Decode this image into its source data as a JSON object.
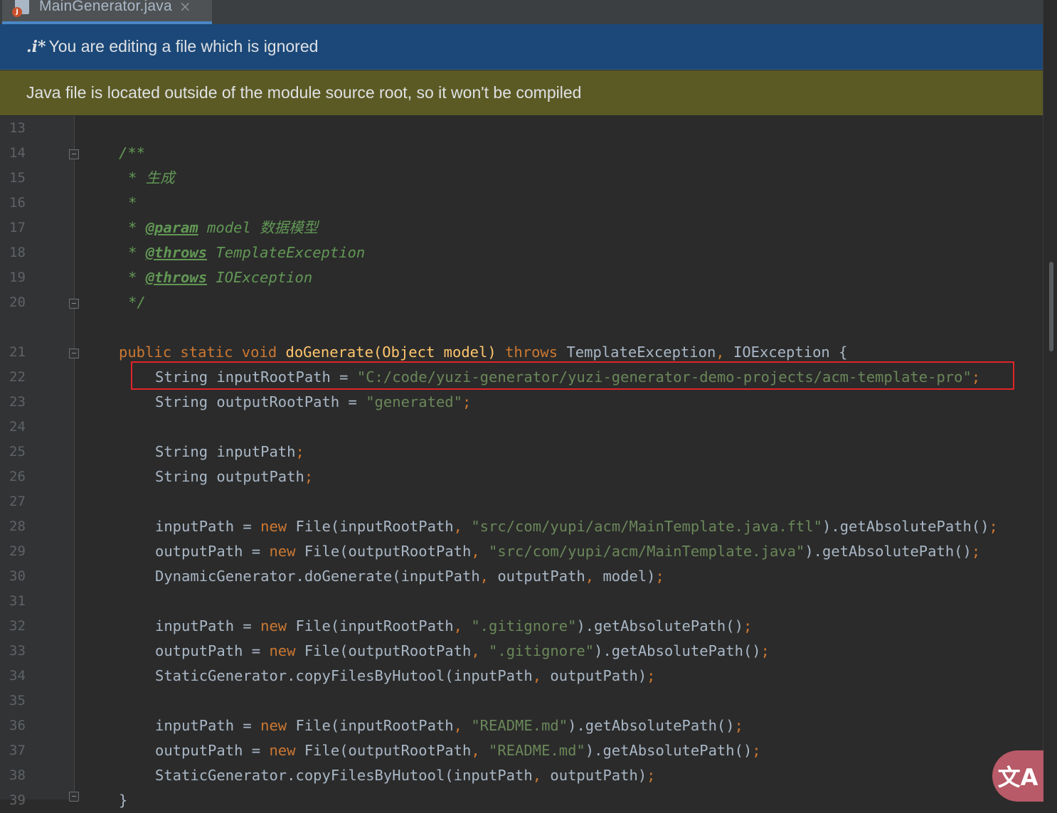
{
  "tab": {
    "title": "MainGenerator.java",
    "close_glyph": "×",
    "icon_letter": "J"
  },
  "banners": {
    "ignored_prefix": ".i*",
    "ignored_text": "You are editing a file which is ignored",
    "warning_text": "Java file is located outside of the module source root, so it won't be compiled"
  },
  "colors": {
    "ignored_banner": "#1b4878",
    "warning_banner": "#5b5a24",
    "highlight_box": "#e0242a",
    "keyword": "#cc7832",
    "string": "#6a8759",
    "doc_comment": "#629755"
  },
  "line_numbers": [
    "13",
    "14",
    "15",
    "16",
    "17",
    "18",
    "19",
    "20",
    "21",
    "22",
    "23",
    "24",
    "25",
    "26",
    "27",
    "28",
    "29",
    "30",
    "31",
    "32",
    "33",
    "34",
    "35",
    "36",
    "37",
    "38",
    "39"
  ],
  "code": {
    "l14": "/**",
    "l15_star": "* ",
    "l15_text": "生成",
    "l16": "*",
    "l17_star": "* ",
    "l17_tag": "@param",
    "l17_name": " model ",
    "l17_desc": "数据模型",
    "l18_star": "* ",
    "l18_tag": "@throws",
    "l18_type": " TemplateException",
    "l19_star": "* ",
    "l19_tag": "@throws",
    "l19_type": " IOException",
    "l20": "*/",
    "l21_kw": "public static void ",
    "l21_name": "doGenerate(Object model) ",
    "l21_throws": "throws ",
    "l21_ex1": "TemplateException",
    "l21_comma": ", ",
    "l21_ex2": "IOException {",
    "l22_decl": "String inputRootPath = ",
    "l22_str": "\"C:/code/yuzi-generator/yuzi-generator-demo-projects/acm-template-pro\"",
    "l23_decl": "String outputRootPath = ",
    "l23_str": "\"generated\"",
    "l25_decl": "String inputPath",
    "l26_decl": "String outputPath",
    "l28_a": "inputPath = ",
    "l28_b": "File(inputRootPath",
    "l28_str": "\"src/com/yupi/acm/MainTemplate.java.ftl\"",
    "l28_c": ").getAbsolutePath()",
    "l29_a": "outputPath = ",
    "l29_b": "File(outputRootPath",
    "l29_str": "\"src/com/yupi/acm/MainTemplate.java\"",
    "l29_c": ").getAbsolutePath()",
    "l30_a": "DynamicGenerator.doGenerate(inputPath",
    "l30_b": "outputPath",
    "l30_c": "model)",
    "l32_a": "inputPath = ",
    "l32_b": "File(inputRootPath",
    "l32_str": "\".gitignore\"",
    "l32_c": ").getAbsolutePath()",
    "l33_a": "outputPath = ",
    "l33_b": "File(outputRootPath",
    "l33_str": "\".gitignore\"",
    "l33_c": ").getAbsolutePath()",
    "l34_a": "StaticGenerator.copyFilesByHutool(inputPath",
    "l34_b": "outputPath)",
    "l36_a": "inputPath = ",
    "l36_b": "File(inputRootPath",
    "l36_str": "\"README.md\"",
    "l36_c": ").getAbsolutePath()",
    "l37_a": "outputPath = ",
    "l37_b": "File(outputRootPath",
    "l37_str": "\"README.md\"",
    "l37_c": ").getAbsolutePath()",
    "l38_a": "StaticGenerator.copyFilesByHutool(inputPath",
    "l38_b": "outputPath)",
    "l39": "}",
    "kw_new": "new ",
    "semi": ";",
    "comma": ", "
  },
  "translate_button": {
    "glyph": "文A",
    "icon": "translate-icon"
  }
}
